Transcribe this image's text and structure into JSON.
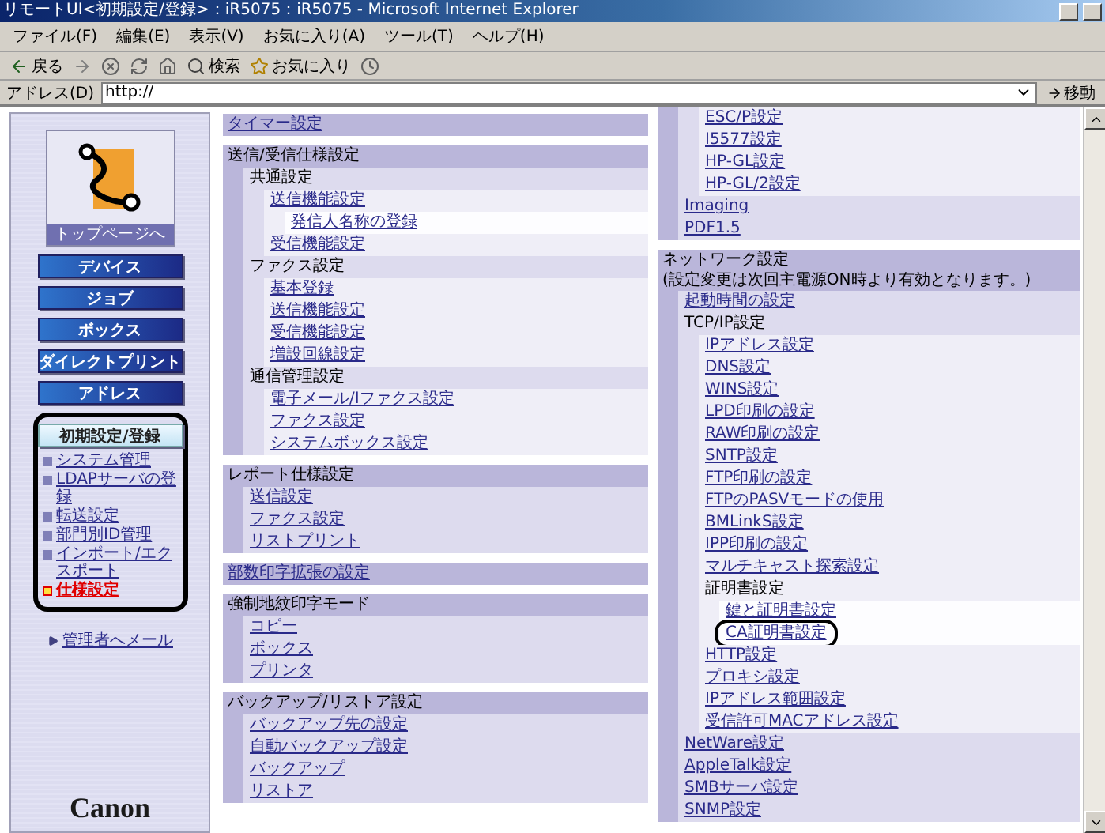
{
  "window": {
    "title": "リモートUI<初期設定/登録>：iR5075：iR5075 - Microsoft Internet Explorer"
  },
  "menu": [
    "ファイル(F)",
    "編集(E)",
    "表示(V)",
    "お気に入り(A)",
    "ツール(T)",
    "ヘルプ(H)"
  ],
  "toolbar": [
    {
      "kind": "back",
      "label": "戻る"
    },
    {
      "kind": "forward"
    },
    {
      "kind": "stop"
    },
    {
      "kind": "refresh"
    },
    {
      "kind": "home"
    },
    {
      "kind": "search",
      "label": "検索"
    },
    {
      "kind": "favorites",
      "label": "お気に入り"
    },
    {
      "kind": "history"
    }
  ],
  "address": {
    "label": "アドレス(D)",
    "value": "http://",
    "go": "移動"
  },
  "sidebar": {
    "top_link": "トップページへ",
    "nav": [
      {
        "label": "デバイス",
        "selected": false
      },
      {
        "label": "ジョブ",
        "selected": false
      },
      {
        "label": "ボックス",
        "selected": false
      },
      {
        "label": "ダイレクトプリント",
        "selected": false
      },
      {
        "label": "アドレス",
        "selected": false
      },
      {
        "label": "初期設定/登録",
        "selected": true
      }
    ],
    "sub_items": [
      {
        "label": "システム管理",
        "selected": false
      },
      {
        "label": "LDAPサーバの登録",
        "selected": false
      },
      {
        "label": "転送設定",
        "selected": false
      },
      {
        "label": "部門別ID管理",
        "selected": false
      },
      {
        "label": "インポート/エクスポート",
        "selected": false
      },
      {
        "label": "仕様設定",
        "selected": true
      }
    ],
    "mail_link": "管理者へメール",
    "brand": "Canon"
  },
  "columns": [
    [
      {
        "title": "タイマー設定",
        "kind": "link"
      },
      {
        "title": "送信/受信仕様設定",
        "kind": "heading",
        "items": [
          {
            "text": "共通設定",
            "kind": "heading",
            "children": [
              {
                "text": "送信機能設定",
                "kind": "link",
                "children": [
                  {
                    "text": "発信人名称の登録",
                    "kind": "link"
                  }
                ]
              },
              {
                "text": "受信機能設定",
                "kind": "link"
              }
            ]
          },
          {
            "text": "ファクス設定",
            "kind": "heading",
            "children": [
              {
                "text": "基本登録",
                "kind": "link"
              },
              {
                "text": "送信機能設定",
                "kind": "link"
              },
              {
                "text": "受信機能設定",
                "kind": "link"
              },
              {
                "text": "増設回線設定",
                "kind": "link"
              }
            ]
          },
          {
            "text": "通信管理設定",
            "kind": "heading",
            "children": [
              {
                "text": "電子メール/Iファクス設定",
                "kind": "link"
              },
              {
                "text": "ファクス設定",
                "kind": "link"
              },
              {
                "text": "システムボックス設定",
                "kind": "link"
              }
            ]
          }
        ]
      },
      {
        "title": "レポート仕様設定",
        "kind": "heading",
        "items": [
          {
            "text": "送信設定",
            "kind": "link"
          },
          {
            "text": "ファクス設定",
            "kind": "link"
          },
          {
            "text": "リストプリント",
            "kind": "link"
          }
        ]
      },
      {
        "title": "部数印字拡張の設定",
        "kind": "link"
      },
      {
        "title": "強制地紋印字モード",
        "kind": "heading",
        "items": [
          {
            "text": "コピー",
            "kind": "link"
          },
          {
            "text": "ボックス",
            "kind": "link"
          },
          {
            "text": "プリンタ",
            "kind": "link"
          }
        ]
      },
      {
        "title": "バックアップ/リストア設定",
        "kind": "heading",
        "items": [
          {
            "text": "バックアップ先の設定",
            "kind": "link"
          },
          {
            "text": "自動バックアップ設定",
            "kind": "link"
          },
          {
            "text": "バックアップ",
            "kind": "link"
          },
          {
            "text": "リストア",
            "kind": "link"
          }
        ]
      }
    ],
    [
      {
        "items": [
          {
            "children": [
              {
                "text": "ESC/P設定",
                "kind": "link"
              },
              {
                "text": "I5577設定",
                "kind": "link"
              },
              {
                "text": "HP-GL設定",
                "kind": "link"
              },
              {
                "text": "HP-GL/2設定",
                "kind": "link"
              }
            ]
          },
          {
            "text": "Imaging",
            "kind": "link"
          },
          {
            "text": "PDF1.5",
            "kind": "link"
          }
        ]
      },
      {
        "title": "ネットワーク設定",
        "kind": "heading",
        "note": "(設定変更は次回主電源ON時より有効となります。)",
        "items": [
          {
            "text": "起動時間の設定",
            "kind": "link"
          },
          {
            "text": "TCP/IP設定",
            "kind": "heading",
            "children": [
              {
                "text": "IPアドレス設定",
                "kind": "link"
              },
              {
                "text": "DNS設定",
                "kind": "link"
              },
              {
                "text": "WINS設定",
                "kind": "link"
              },
              {
                "text": "LPD印刷の設定",
                "kind": "link"
              },
              {
                "text": "RAW印刷の設定",
                "kind": "link"
              },
              {
                "text": "SNTP設定",
                "kind": "link"
              },
              {
                "text": "FTP印刷の設定",
                "kind": "link"
              },
              {
                "text": "FTPのPASVモードの使用",
                "kind": "link"
              },
              {
                "text": "BMLinkS設定",
                "kind": "link"
              },
              {
                "text": "IPP印刷の設定",
                "kind": "link"
              },
              {
                "text": "マルチキャスト探索設定",
                "kind": "link"
              },
              {
                "text": "証明書設定",
                "kind": "heading",
                "children": [
                  {
                    "text": "鍵と証明書設定",
                    "kind": "link",
                    "circled": false
                  },
                  {
                    "text": "CA証明書設定",
                    "kind": "link",
                    "circled": true
                  }
                ]
              },
              {
                "text": "HTTP設定",
                "kind": "link"
              },
              {
                "text": "プロキシ設定",
                "kind": "link"
              },
              {
                "text": "IPアドレス範囲設定",
                "kind": "link"
              },
              {
                "text": "受信許可MACアドレス設定",
                "kind": "link"
              }
            ]
          },
          {
            "text": "NetWare設定",
            "kind": "link"
          },
          {
            "text": "AppleTalk設定",
            "kind": "link"
          },
          {
            "text": "SMBサーバ設定",
            "kind": "link"
          },
          {
            "text": "SNMP設定",
            "kind": "link"
          }
        ]
      }
    ]
  ]
}
